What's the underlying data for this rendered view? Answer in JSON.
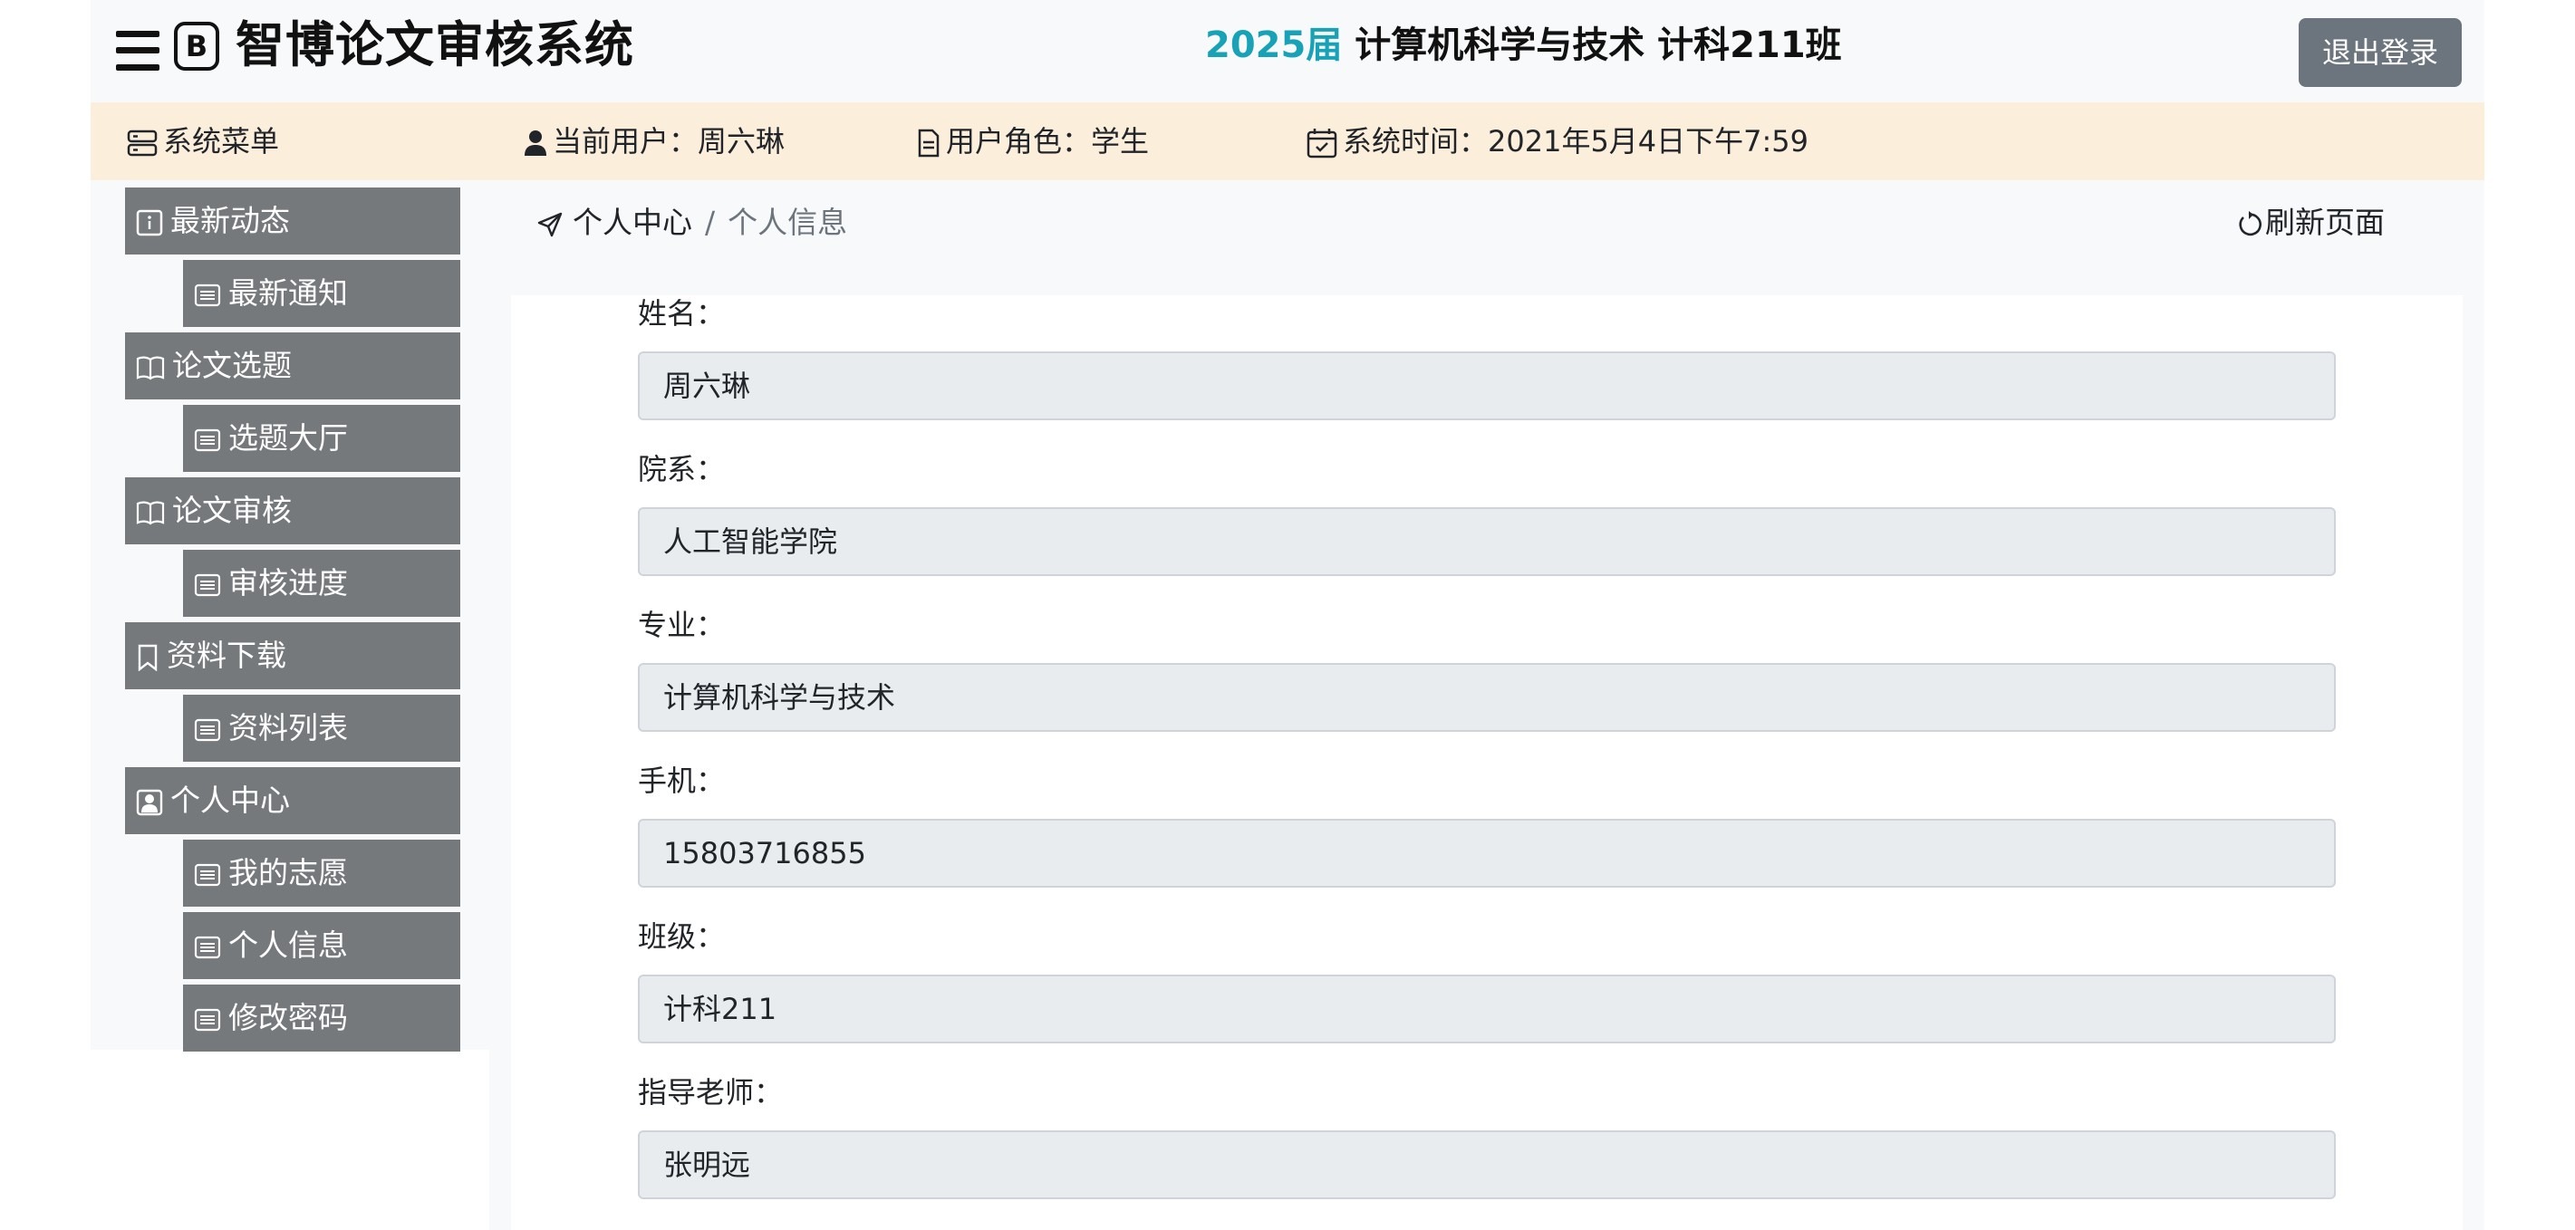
{
  "header": {
    "brand_title": "智博论文审核系统",
    "brand_icon_letter": "B",
    "year_label": "2025届",
    "class_label": " 计算机科学与技术 计科211班",
    "logout_label": "退出登录"
  },
  "infobar": {
    "menu_label": "系统菜单",
    "user_label": "当前用户：周六琳",
    "role_label": "用户角色：学生",
    "time_label": "系统时间：2021年5月4日下午7:59"
  },
  "sidebar": {
    "items": [
      {
        "label": "最新动态",
        "icon": "info-icon"
      },
      {
        "label": "最新通知",
        "icon": "list-icon"
      },
      {
        "label": "论文选题",
        "icon": "book-icon"
      },
      {
        "label": "选题大厅",
        "icon": "list-icon"
      },
      {
        "label": "论文审核",
        "icon": "book-icon"
      },
      {
        "label": "审核进度",
        "icon": "list-icon"
      },
      {
        "label": "资料下载",
        "icon": "bookmark-icon"
      },
      {
        "label": "资料列表",
        "icon": "list-icon"
      },
      {
        "label": "个人中心",
        "icon": "person-badge-icon"
      },
      {
        "label": "我的志愿",
        "icon": "list-icon"
      },
      {
        "label": "个人信息",
        "icon": "list-icon"
      },
      {
        "label": "修改密码",
        "icon": "list-icon"
      }
    ]
  },
  "breadcrumb": {
    "parent": "个人中心",
    "separator": "/",
    "current": "个人信息"
  },
  "refresh_label": "刷新页面",
  "form": {
    "fields": [
      {
        "label": "姓名：",
        "value": "周六琳"
      },
      {
        "label": "院系：",
        "value": "人工智能学院"
      },
      {
        "label": "专业：",
        "value": "计算机科学与技术"
      },
      {
        "label": "手机：",
        "value": "15803716855"
      },
      {
        "label": "班级：",
        "value": "计科211"
      },
      {
        "label": "指导老师：",
        "value": "张明远"
      }
    ]
  },
  "colors": {
    "accent_year": "#17a2b8",
    "infobar_bg": "#fbeedb",
    "menu_bg": "#75797c",
    "logout_bg": "#6c757d"
  }
}
